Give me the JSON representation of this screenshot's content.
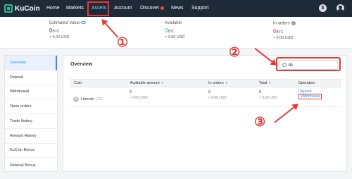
{
  "nav": {
    "logo": "KuCoin",
    "items": [
      "Home",
      "Markets",
      "Assets",
      "Account",
      "Discover",
      "News",
      "Support"
    ],
    "dollar_glyph": "$"
  },
  "summary": {
    "estimated": {
      "label": "Estimated Value",
      "value": "0",
      "unit": "BTC",
      "fiat": "≈ 0.00 USD"
    },
    "available": {
      "label": "Available",
      "value": "0",
      "unit": "BTC",
      "fiat": "≈ 0.00 USD"
    },
    "in_orders": {
      "label": "In orders",
      "value": "0",
      "unit": "BTC",
      "fiat": "≈ 0.00 USD",
      "info_glyph": "?"
    }
  },
  "sidebar": {
    "items": [
      "Overview",
      "Deposit",
      "Withdrawal",
      "Open orders",
      "Trade history",
      "Reward History",
      "KuCoin Bonus",
      "Referral Bonus"
    ]
  },
  "panel": {
    "title": "Overview",
    "search": {
      "value": "ltc",
      "placeholder": ""
    },
    "columns": [
      "Coin",
      "Available amount",
      "In orders",
      "Total",
      "Operation"
    ],
    "rows": [
      {
        "coin": "Litecoin",
        "ticker": "LTC",
        "icon_glyph": "Ł",
        "available": "0",
        "available_fiat": "≈ 0.00 USD",
        "in_orders": "0",
        "in_orders_fiat": "≈ 0.00 USD",
        "total": "0",
        "total_fiat": "≈ 0.00 USD",
        "deposit": "Deposit",
        "withdrawal": "Withdrawal"
      }
    ]
  },
  "annotations": {
    "one": "①",
    "two": "②",
    "three": "③"
  },
  "colors": {
    "nav_bg": "#1f2a38",
    "accent": "#3a8ee6",
    "annotation": "#e53935",
    "logo": "#23b993"
  }
}
